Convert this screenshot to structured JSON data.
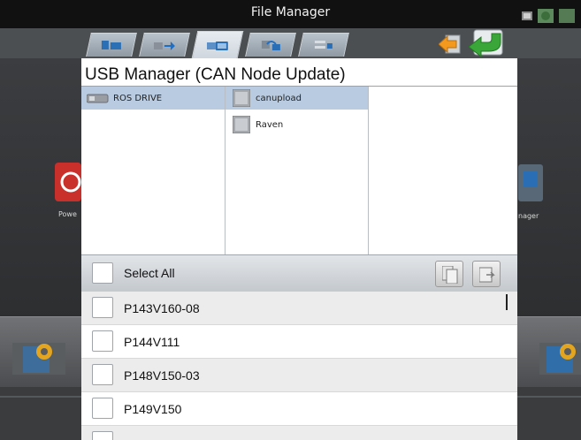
{
  "window": {
    "title": "File Manager"
  },
  "tabs": [
    {
      "name": "local-storage-tab",
      "icon": "drive-icon",
      "active": false
    },
    {
      "name": "transfer-tab",
      "icon": "transfer-arrow-icon",
      "active": false
    },
    {
      "name": "usb-tab",
      "icon": "usb-drive-icon",
      "active": true
    },
    {
      "name": "network-tab",
      "icon": "network-icon",
      "active": false
    },
    {
      "name": "list-tab",
      "icon": "list-icon",
      "active": false
    }
  ],
  "background_apps": {
    "left_label": "Powe",
    "right_label": "nager"
  },
  "dialog": {
    "title": "USB Manager (CAN Node Update)",
    "drives": [
      {
        "label": "ROS DRIVE",
        "selected": true
      }
    ],
    "folders": [
      {
        "label": "canupload",
        "selected": true
      },
      {
        "label": "Raven",
        "selected": false
      }
    ],
    "select_all_label": "Select All",
    "files": [
      {
        "label": "P143V160-08",
        "checked": false
      },
      {
        "label": "P144V111",
        "checked": false
      },
      {
        "label": "P148V150-03",
        "checked": false
      },
      {
        "label": "P149V150",
        "checked": false
      },
      {
        "label": "",
        "checked": false
      }
    ]
  },
  "colors": {
    "selection": "#b9cbe0",
    "title_bar": "#111111",
    "accent_green": "#3aa63a",
    "accent_orange": "#f39a1e"
  }
}
